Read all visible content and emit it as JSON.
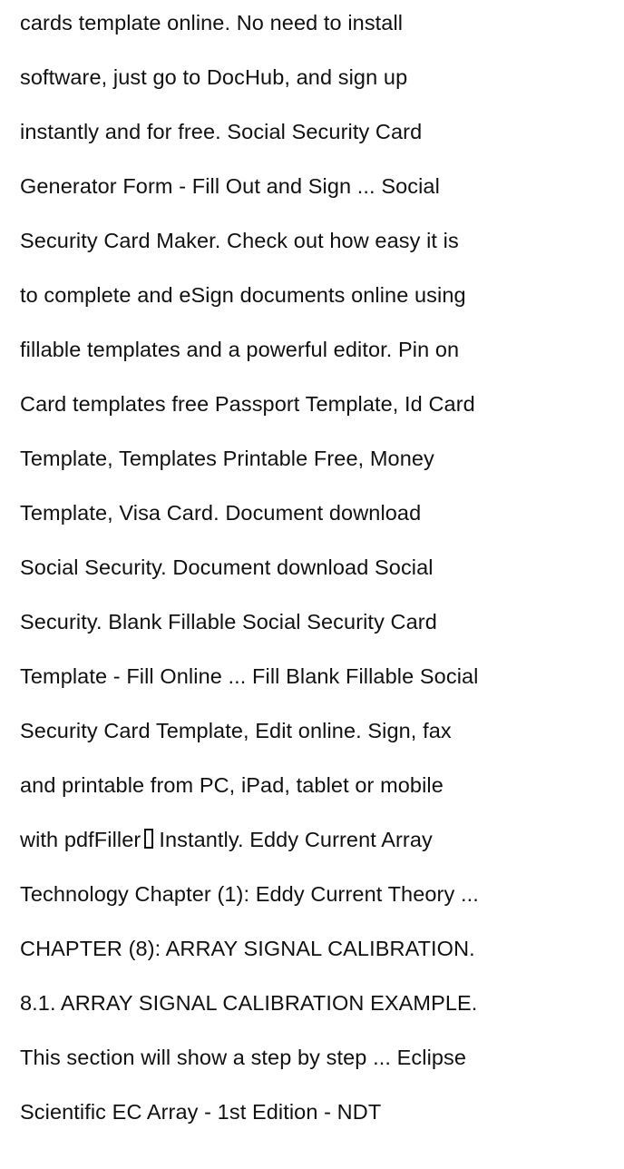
{
  "article": {
    "lines": [
      "cards template online. No need to install",
      "software, just go to DocHub, and sign up",
      "instantly and for free. Social Security Card",
      "Generator Form - Fill Out and Sign ... Social",
      "Security Card Maker. Check out how easy it is",
      "to complete and eSign documents online using",
      "fillable templates and a powerful editor. Pin on",
      "Card templates free Passport Template, Id Card",
      "Template, Templates Printable Free, Money",
      "Template, Visa Card. Document download",
      "Social Security. Document download Social",
      "Security. Blank Fillable Social Security Card",
      "Template - Fill Online ... Fill Blank Fillable Social",
      "Security Card Template, Edit online. Sign, fax",
      "and printable from PC, iPad, tablet or mobile",
      "",
      "Technology Chapter (1): Eddy Current Theory ...",
      "CHAPTER (8): ARRAY SIGNAL CALIBRATION.",
      "8.1. ARRAY SIGNAL CALIBRATION EXAMPLE.",
      "This section will show a step by step ... Eclipse",
      "Scientific EC Array - 1st Edition - NDT"
    ],
    "line16_before": "with pdfFiller",
    "line16_after": "Instantly. Eddy Current Array"
  }
}
